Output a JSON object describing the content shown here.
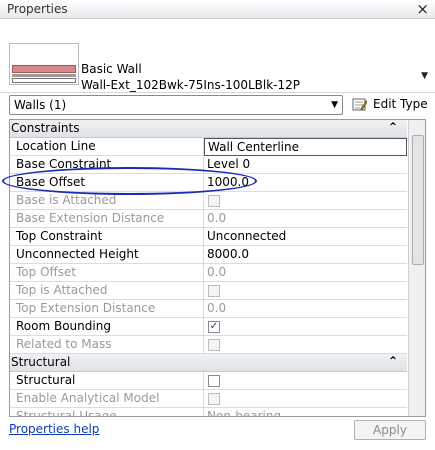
{
  "window": {
    "title": "Properties"
  },
  "type_selector": {
    "family": "Basic Wall",
    "type": "Wall-Ext_102Bwk-75Ins-100LBlk-12P"
  },
  "filter": {
    "selected": "Walls (1)"
  },
  "edit_type": {
    "label": "Edit Type"
  },
  "groups": {
    "constraints": "Constraints",
    "structural": "Structural"
  },
  "rows": {
    "location_line": {
      "label": "Location Line",
      "value": "Wall Centerline"
    },
    "base_constraint": {
      "label": "Base Constraint",
      "value": "Level 0"
    },
    "base_offset": {
      "label": "Base Offset",
      "value": "1000.0"
    },
    "base_is_attached": {
      "label": "Base is Attached"
    },
    "base_extension_distance": {
      "label": "Base Extension Distance",
      "value": "0.0"
    },
    "top_constraint": {
      "label": "Top Constraint",
      "value": "Unconnected"
    },
    "unconnected_height": {
      "label": "Unconnected Height",
      "value": "8000.0"
    },
    "top_offset": {
      "label": "Top Offset",
      "value": "0.0"
    },
    "top_is_attached": {
      "label": "Top is Attached"
    },
    "top_extension_distance": {
      "label": "Top Extension Distance",
      "value": "0.0"
    },
    "room_bounding": {
      "label": "Room Bounding",
      "checked": true
    },
    "related_to_mass": {
      "label": "Related to Mass"
    },
    "structural": {
      "label": "Structural"
    },
    "enable_analytical_model": {
      "label": "Enable Analytical Model"
    },
    "structural_usage": {
      "label": "Structural Usage",
      "value": "Non-bearing"
    }
  },
  "footer": {
    "help_link": "Properties help",
    "apply_label": "Apply"
  },
  "colors": {
    "annotation": "#1a2fb0",
    "link": "#0b3bb8"
  }
}
